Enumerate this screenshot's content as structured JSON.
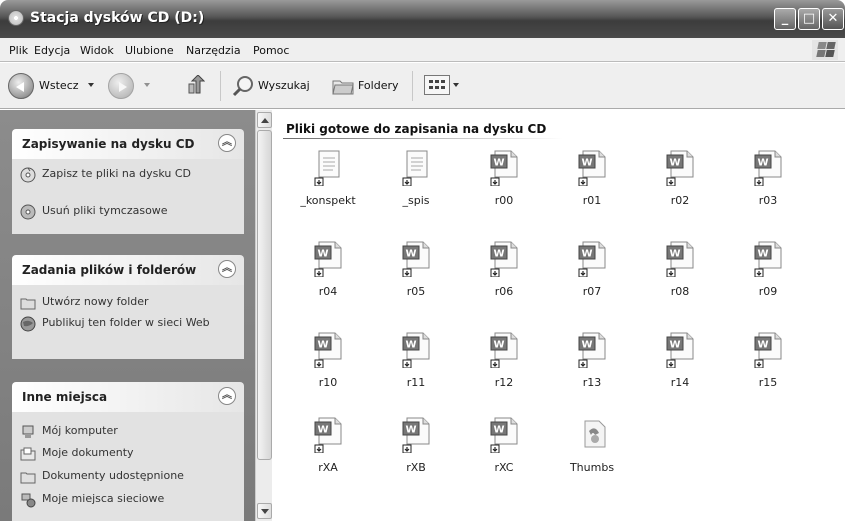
{
  "window": {
    "title": "Stacja dysków CD (D:)"
  },
  "menu": [
    "Plik",
    "Edycja",
    "Widok",
    "Ulubione",
    "Narzędzia",
    "Pomoc"
  ],
  "toolbar": {
    "back_label": "Wstecz",
    "search_label": "Wyszukaj",
    "folders_label": "Foldery"
  },
  "sidebar": {
    "panels": [
      {
        "title": "Zapisywanie na dysku CD",
        "tasks": [
          {
            "label": "Zapisz te pliki na dysku CD",
            "icon": "burn-cd-icon"
          },
          {
            "label": "Usuń pliki tymczasowe",
            "icon": "delete-temp-files-icon"
          }
        ]
      },
      {
        "title": "Zadania plików i folderów",
        "tasks": [
          {
            "label": "Utwórz nowy folder",
            "icon": "new-folder-icon"
          },
          {
            "label": "Publikuj ten folder w sieci Web",
            "icon": "publish-web-icon"
          }
        ]
      },
      {
        "title": "Inne miejsca",
        "tasks": [
          {
            "label": "Mój komputer",
            "icon": "my-computer-icon"
          },
          {
            "label": "Moje dokumenty",
            "icon": "my-documents-icon"
          },
          {
            "label": "Dokumenty udostępnione",
            "icon": "shared-documents-icon"
          },
          {
            "label": "Moje miejsca sieciowe",
            "icon": "network-places-icon"
          }
        ]
      }
    ]
  },
  "main": {
    "group_title": "Pliki gotowe do zapisania na dysku CD",
    "files": [
      {
        "name": "_konspekt",
        "type": "text"
      },
      {
        "name": "_spis",
        "type": "text"
      },
      {
        "name": "r00",
        "type": "word"
      },
      {
        "name": "r01",
        "type": "word"
      },
      {
        "name": "r02",
        "type": "word"
      },
      {
        "name": "r03",
        "type": "word"
      },
      {
        "name": "r04",
        "type": "word"
      },
      {
        "name": "r05",
        "type": "word"
      },
      {
        "name": "r06",
        "type": "word"
      },
      {
        "name": "r07",
        "type": "word"
      },
      {
        "name": "r08",
        "type": "word"
      },
      {
        "name": "r09",
        "type": "word"
      },
      {
        "name": "r10",
        "type": "word"
      },
      {
        "name": "r11",
        "type": "word"
      },
      {
        "name": "r12",
        "type": "word"
      },
      {
        "name": "r13",
        "type": "word"
      },
      {
        "name": "r14",
        "type": "word"
      },
      {
        "name": "r15",
        "type": "word"
      },
      {
        "name": "rXA",
        "type": "word"
      },
      {
        "name": "rXB",
        "type": "word"
      },
      {
        "name": "rXC",
        "type": "word"
      },
      {
        "name": "Thumbs",
        "type": "thumbs"
      }
    ]
  }
}
